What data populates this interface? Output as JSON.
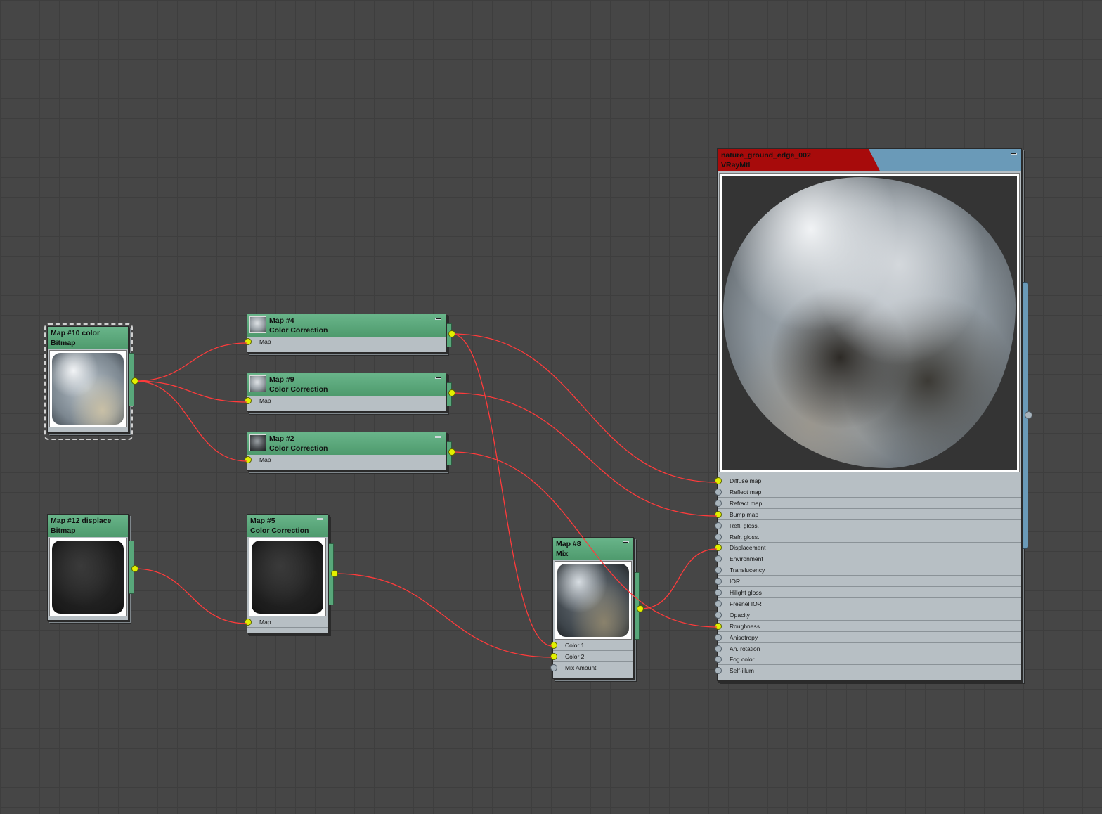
{
  "colors": {
    "wire": "#ff3b3b",
    "socket_connected": "#e2f000",
    "socket_empty": "#a8b4bc",
    "map_header": "#5ba67c",
    "material_header_left": "#a70b0b",
    "material_header_right": "#6a9ab8",
    "canvas": "#464646"
  },
  "nodes": {
    "map10": {
      "title": "Map #10 color",
      "type": "Bitmap"
    },
    "map12": {
      "title": "Map #12 displace",
      "type": "Bitmap"
    },
    "map4": {
      "title": "Map #4",
      "type": "Color Correction",
      "slots": [
        "Map"
      ]
    },
    "map9": {
      "title": "Map #9",
      "type": "Color Correction",
      "slots": [
        "Map"
      ]
    },
    "map2": {
      "title": "Map #2",
      "type": "Color Correction",
      "slots": [
        "Map"
      ]
    },
    "map5": {
      "title": "Map #5",
      "type": "Color Correction",
      "slots": [
        "Map"
      ]
    },
    "map8": {
      "title": "Map #8",
      "type": "Mix",
      "slots": [
        "Color 1",
        "Color 2",
        "Mix Amount"
      ]
    },
    "material": {
      "title": "nature_ground_edge_002",
      "type": "VRayMtl",
      "slots": [
        "Diffuse map",
        "Reflect map",
        "Refract map",
        "Bump map",
        "Refl. gloss.",
        "Refr. gloss.",
        "Displacement",
        "Environment",
        "Translucency",
        "IOR",
        "Hilight gloss",
        "Fresnel IOR",
        "Opacity",
        "Roughness",
        "Anisotropy",
        "An. rotation",
        "Fog color",
        "Self-illum"
      ]
    }
  }
}
